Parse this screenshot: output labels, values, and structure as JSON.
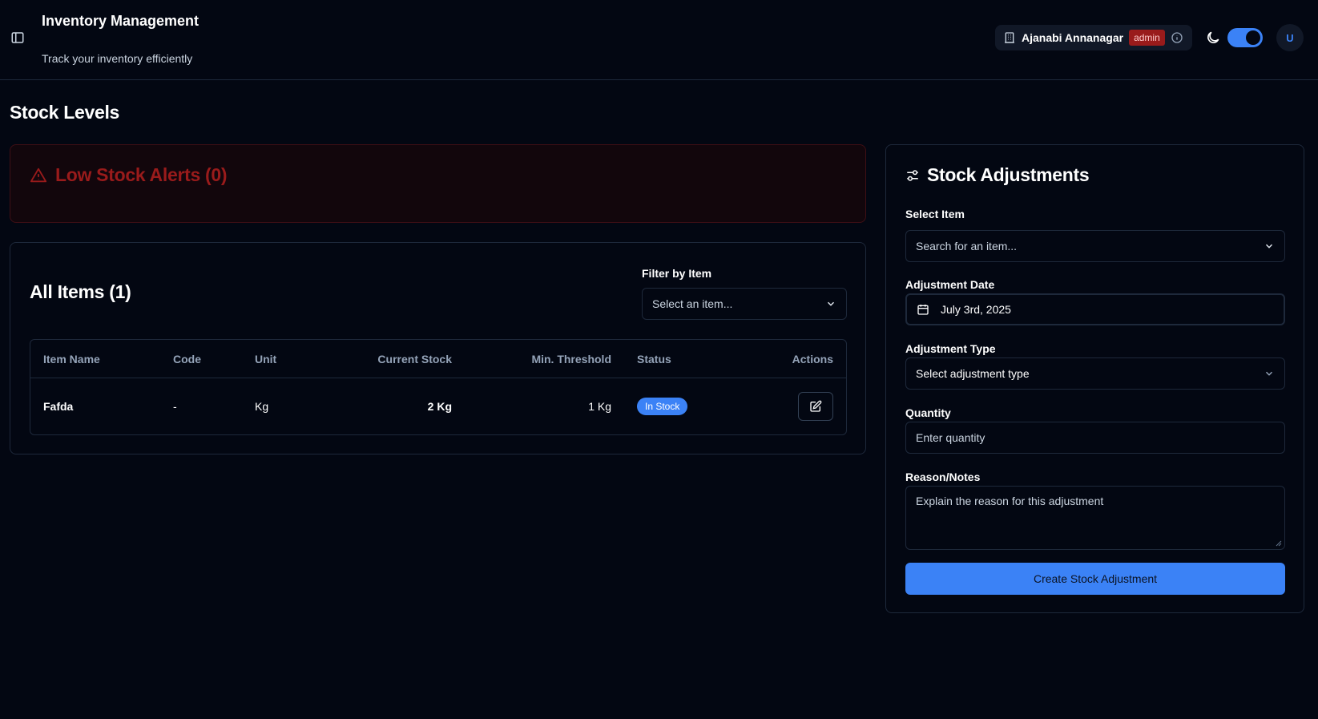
{
  "header": {
    "title": "Inventory Management",
    "subtitle": "Track your inventory efficiently",
    "branch": "Ajanabi Annanagar",
    "role": "admin",
    "avatar_initial": "U"
  },
  "page": {
    "title": "Stock Levels"
  },
  "alerts": {
    "title": "Low Stock Alerts (0)"
  },
  "items": {
    "title": "All Items (1)",
    "filter_label": "Filter by Item",
    "filter_placeholder": "Select an item...",
    "columns": [
      "Item Name",
      "Code",
      "Unit",
      "Current Stock",
      "Min. Threshold",
      "Status",
      "Actions"
    ],
    "rows": [
      {
        "name": "Fafda",
        "code": "-",
        "unit": "Kg",
        "current_stock": "2 Kg",
        "min_threshold": "1 Kg",
        "status": "In Stock"
      }
    ]
  },
  "adjustments": {
    "title": "Stock Adjustments",
    "select_item_label": "Select Item",
    "select_item_placeholder": "Search for an item...",
    "date_label": "Adjustment Date",
    "date_value": "July 3rd, 2025",
    "type_label": "Adjustment Type",
    "type_placeholder": "Select adjustment type",
    "quantity_label": "Quantity",
    "quantity_placeholder": "Enter quantity",
    "notes_label": "Reason/Notes",
    "notes_placeholder": "Explain the reason for this adjustment",
    "submit_label": "Create Stock Adjustment"
  },
  "colors": {
    "background": "#030712",
    "accent": "#3b82f6",
    "danger": "#991b1b",
    "border": "#1e293b"
  },
  "icons": {
    "sidebar_toggle": "panel-left-icon",
    "branch": "building-icon",
    "info": "info-icon",
    "theme": "moon-icon",
    "alert": "alert-triangle-icon",
    "chevron": "chevron-down-icon",
    "calendar": "calendar-icon",
    "adjustments": "sliders-icon",
    "edit": "edit-icon"
  }
}
